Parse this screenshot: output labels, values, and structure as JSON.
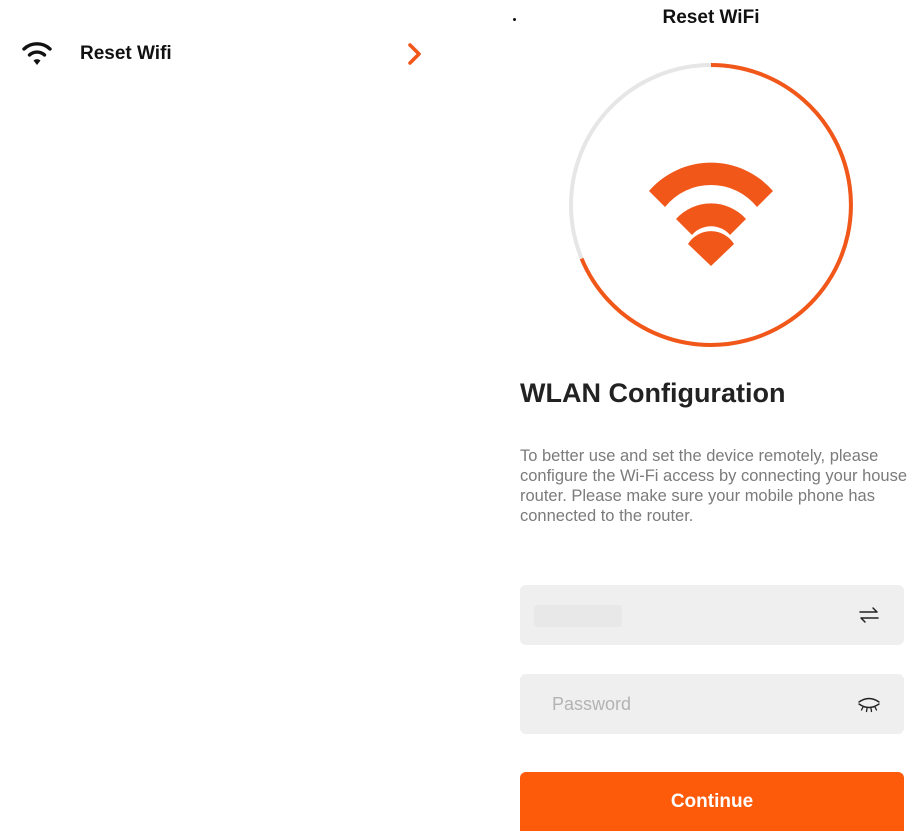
{
  "left_panel": {
    "row": {
      "label": "Reset Wifi",
      "icon": "wifi-icon",
      "chevron_icon": "chevron-right-icon"
    }
  },
  "screen": {
    "nav_title": "Reset WiFi",
    "hero_icon": "wifi-icon",
    "section_title": "WLAN Configuration",
    "description": "To better use and set the device remotely, please configure the Wi-Fi access by connecting your house router. Please make sure your mobile phone has connected to the router.",
    "ssid_field": {
      "value": "",
      "icon": "switch-network-icon"
    },
    "password_field": {
      "placeholder": "Password",
      "icon": "eye-closed-icon"
    },
    "continue_label": "Continue"
  },
  "colors": {
    "accent": "#fd5a0a",
    "field_background": "#efefef",
    "ring_track": "#e6e6e6",
    "description_text": "#7b7b7b"
  }
}
